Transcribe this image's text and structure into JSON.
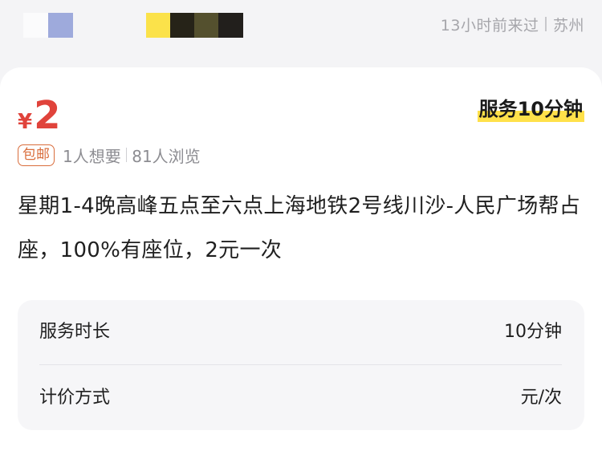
{
  "header": {
    "color_blocks": [
      "#fbfbfc",
      "#9eaadc",
      "#fbe24a",
      "#262318",
      "#54502e",
      "#221f1c"
    ],
    "last_seen": "13小时前来过",
    "location": "苏州"
  },
  "listing": {
    "currency": "¥",
    "price": "2",
    "duration_tag": "服务10分钟",
    "shipping_badge": "包邮",
    "wants": "1人想要",
    "views": "81人浏览",
    "description": "星期1-4晚高峰五点至六点上海地铁2号线川沙-人民广场帮占座，100%有座位，2元一次"
  },
  "details": [
    {
      "label": "服务时长",
      "value": "10分钟"
    },
    {
      "label": "计价方式",
      "value": "元/次"
    }
  ],
  "colors": {
    "price": "#e0433b",
    "highlight": "#ffe14a",
    "badge": "#d96d3c"
  }
}
